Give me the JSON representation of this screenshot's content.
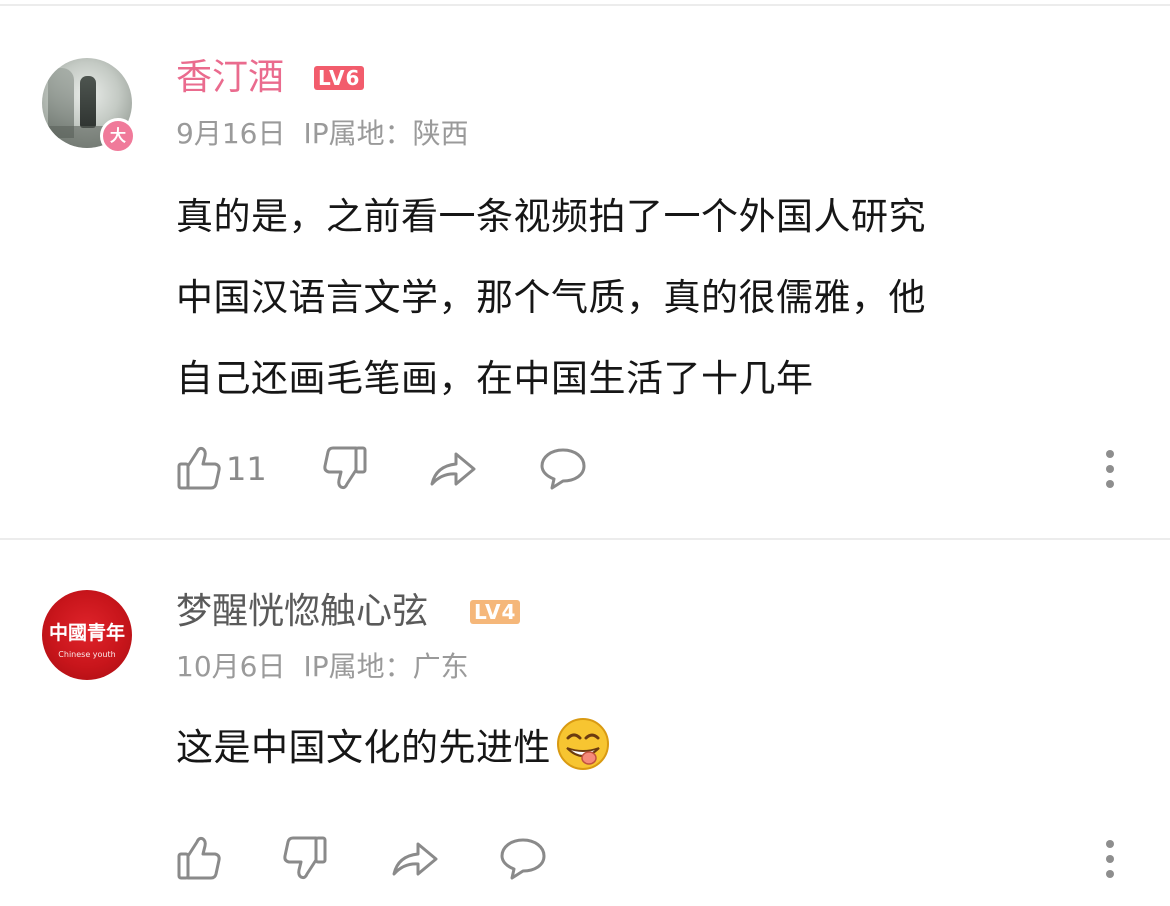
{
  "comments": [
    {
      "username": "香汀酒",
      "level": "LV6",
      "avatar_badge": "大",
      "date": "9月16日",
      "ip_location": "IP属地：陕西",
      "text_lines": [
        "真的是，之前看一条视频拍了一个外国人研究",
        "中国汉语言文学，那个气质，真的很儒雅，他",
        "自己还画毛笔画，在中国生活了十几年"
      ],
      "like_count": "11",
      "accent_color": "#ea6b8e"
    },
    {
      "username": "梦醒恍惚触心弦",
      "level": "LV4",
      "avatar_text": "中國青年",
      "avatar_subtext": "Chinese youth",
      "date": "10月6日",
      "ip_location": "IP属地：广东",
      "text": "这是中国文化的先进性",
      "emoji": "grinning-tongue-emoji"
    }
  ],
  "icons": [
    "thumbs-up-icon",
    "thumbs-down-icon",
    "share-icon",
    "reply-icon",
    "more-icon"
  ]
}
